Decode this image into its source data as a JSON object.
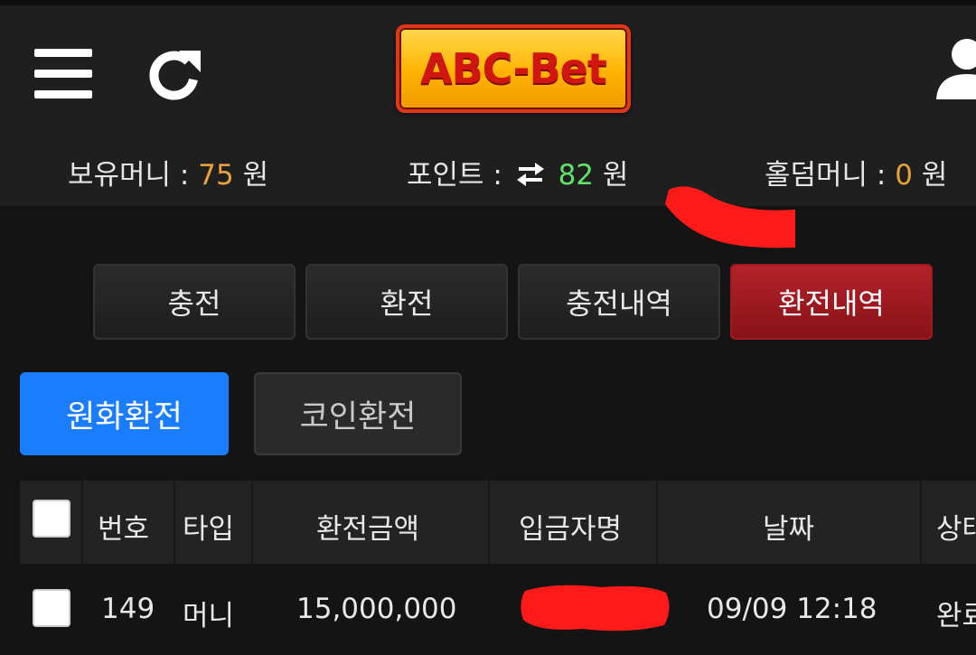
{
  "header": {
    "logo_text": "ABC-Bet",
    "icons": [
      "menu-icon",
      "refresh-icon",
      "user-icon"
    ]
  },
  "balances": {
    "money_label": "보유머니 :",
    "money_value": "75",
    "money_unit": "원",
    "point_label": "포인트 :",
    "point_value": "82",
    "point_unit": "원",
    "hold_label": "홀덤머니 :",
    "hold_value": "0",
    "hold_unit": "원"
  },
  "tabs": [
    {
      "label": "충전"
    },
    {
      "label": "환전"
    },
    {
      "label": "충전내역"
    },
    {
      "label": "환전내역",
      "active": true
    }
  ],
  "subtabs": [
    {
      "label": "원화환전",
      "active": true
    },
    {
      "label": "코인환전"
    }
  ],
  "table": {
    "headers": [
      "번호",
      "타입",
      "환전금액",
      "입금자명",
      "날짜",
      "상태"
    ],
    "rows": [
      {
        "no": "149",
        "type": "머니",
        "amount": "15,000,000",
        "name": "",
        "date": "09/09 12:18",
        "status": "완료"
      }
    ]
  },
  "colors": {
    "accent_blue": "#1a7dff",
    "active_tab_red": "#b4222a",
    "point_green": "#5fe36a",
    "money_orange": "#e6a23c"
  }
}
